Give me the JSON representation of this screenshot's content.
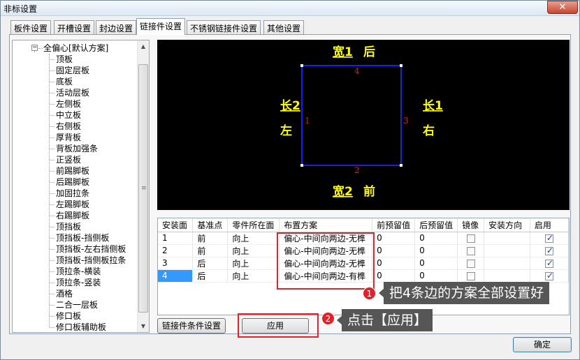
{
  "window": {
    "title": "非标设置",
    "close_glyph": "✕"
  },
  "tabs": [
    "板件设置",
    "开槽设置",
    "封边设置",
    "链接件设置",
    "不锈钢链接件设置",
    "其他设置"
  ],
  "active_tab": 3,
  "tree": {
    "root": "全偏心[默认方案]",
    "expander": "−",
    "items": [
      "顶板",
      "固定层板",
      "底板",
      "活动层板",
      "左侧板",
      "中立板",
      "右侧板",
      "厚背板",
      "背板加强条",
      "正竖板",
      "前踢脚板",
      "后踢脚板",
      "加固拉条",
      "左踢脚板",
      "右踢脚板",
      "顶挡板",
      "顶挡板-挡侧板",
      "顶挡板-左右挡侧板",
      "顶挡板-挡侧板拉条",
      "顶拉条-横装",
      "顶拉条-竖装",
      "酒格",
      "二合一层板",
      "修口板",
      "修口板辅助板"
    ],
    "scroll_up": "▲",
    "scroll_down": "▼",
    "grip": "≡"
  },
  "preview": {
    "top_label_u": "宽1",
    "top_label_dir": "后",
    "bottom_label_u": "宽2",
    "bottom_label_dir": "前",
    "left_label_u": "长2",
    "left_label_dir": "左",
    "right_label_u": "长1",
    "right_label_dir": "右",
    "edge_top": "4",
    "edge_bottom": "2",
    "edge_left": "1",
    "edge_right": "3",
    "colors": {
      "rect": "#1e1ee6",
      "label": "#ffff00",
      "edge_num": "#e01e1e"
    }
  },
  "grid": {
    "headers": [
      "安装面",
      "基准点",
      "零件所在面",
      "布置方案",
      "前预留值",
      "后预留值",
      "镜像",
      "安装方向",
      "启用"
    ],
    "rows": [
      {
        "face": "1",
        "ref": "前",
        "side": "向上",
        "scheme": "偏心-中间向两边-无榫",
        "front": "0",
        "back": "0",
        "mirror": false,
        "dir": "",
        "enabled": true
      },
      {
        "face": "2",
        "ref": "前",
        "side": "向上",
        "scheme": "偏心-中间向两边-无榫",
        "front": "0",
        "back": "0",
        "mirror": false,
        "dir": "",
        "enabled": true
      },
      {
        "face": "3",
        "ref": "后",
        "side": "向上",
        "scheme": "偏心-中间向两边-无榫",
        "front": "0",
        "back": "0",
        "mirror": false,
        "dir": "",
        "enabled": true
      },
      {
        "face": "4",
        "ref": "后",
        "side": "向上",
        "scheme": "偏心-中间向两边-有榫",
        "front": "0",
        "back": "0",
        "mirror": false,
        "dir": "",
        "enabled": true
      }
    ],
    "selected_row": 3
  },
  "buttons": {
    "condition": "链接件条件设置",
    "apply": "应用",
    "ok": "确定"
  },
  "callouts": {
    "step1_num": "1",
    "step1_text": "把4条边的方案全部设置好",
    "step2_num": "2",
    "step2_text": "点击【应用】",
    "color": "#e5202a"
  }
}
